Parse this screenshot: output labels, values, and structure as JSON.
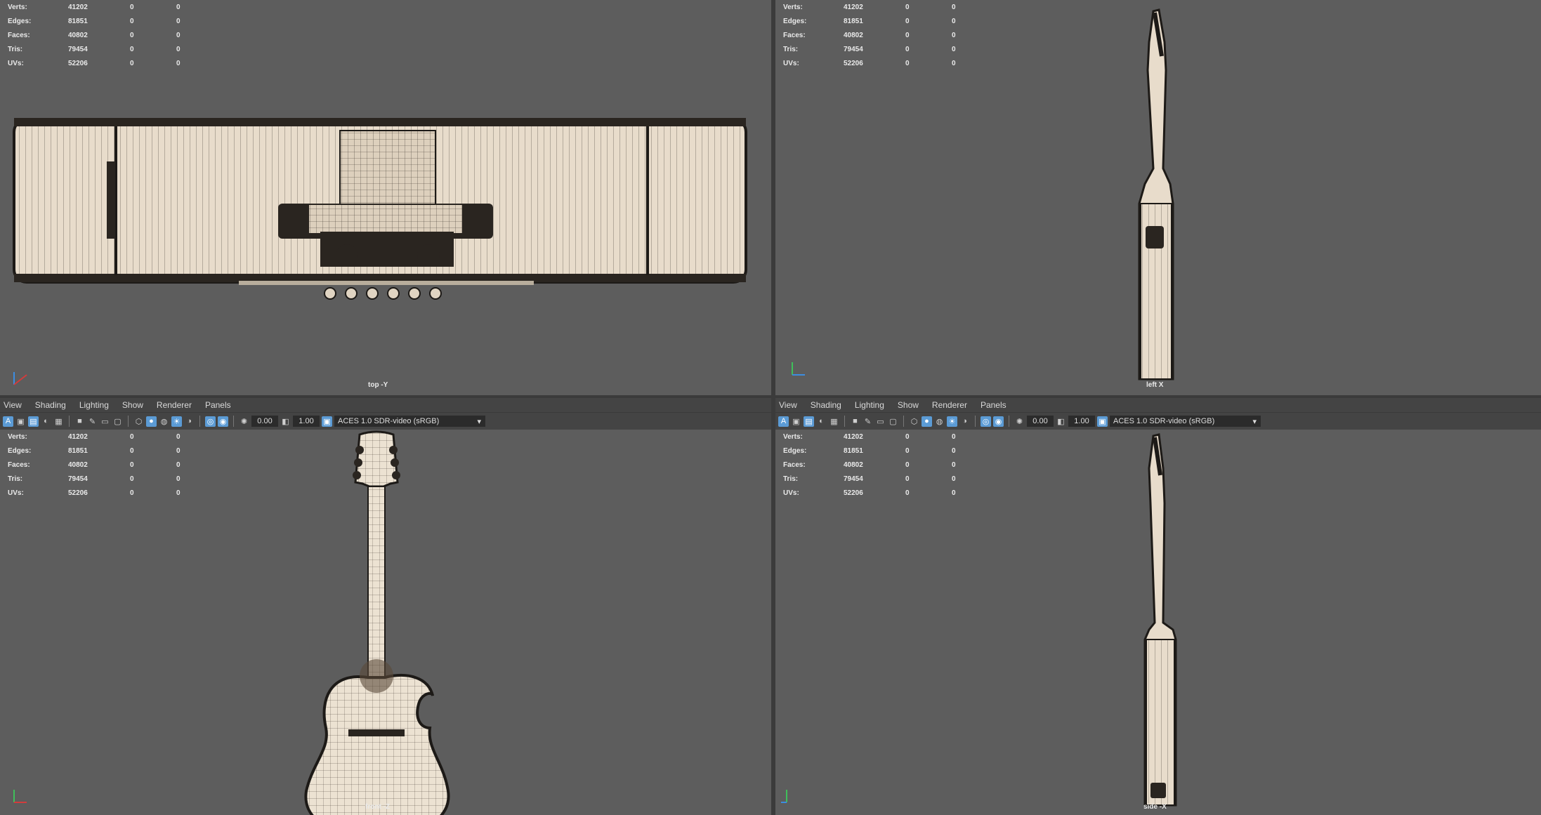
{
  "menus": [
    "View",
    "Shading",
    "Lighting",
    "Show",
    "Renderer",
    "Panels"
  ],
  "toolbar": {
    "field_a": "0.00",
    "field_b": "1.00",
    "colorspace": "ACES 1.0 SDR-video (sRGB)"
  },
  "hud": [
    {
      "key": "Verts:",
      "value": "41202",
      "z1": "0",
      "z2": "0"
    },
    {
      "key": "Edges:",
      "value": "81851",
      "z1": "0",
      "z2": "0"
    },
    {
      "key": "Faces:",
      "value": "40802",
      "z1": "0",
      "z2": "0"
    },
    {
      "key": "Tris:",
      "value": "79454",
      "z1": "0",
      "z2": "0"
    },
    {
      "key": "UVs:",
      "value": "52206",
      "z1": "0",
      "z2": "0"
    }
  ],
  "viewports": {
    "top_left": {
      "label": "top -Y"
    },
    "top_right": {
      "label": "left X"
    },
    "bottom_left": {
      "label": "front -Z"
    },
    "bottom_right": {
      "label": "side -X"
    }
  },
  "colors": {
    "viewport_bg": "#5d5d5d",
    "toolbar_bg": "#444444",
    "accent": "#5b9bd5",
    "mesh_fill": "#e8dccb",
    "mesh_line": "#2a2520"
  }
}
